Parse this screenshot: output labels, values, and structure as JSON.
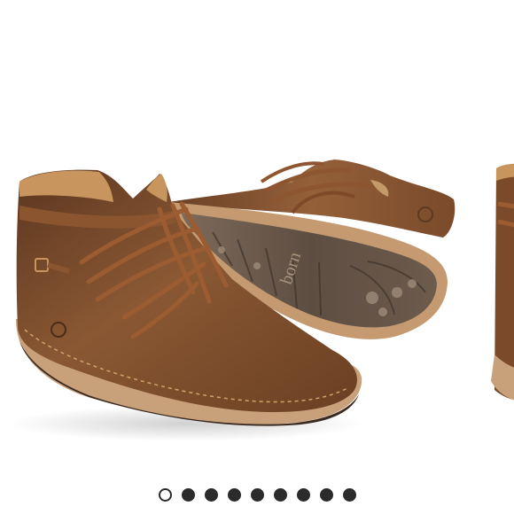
{
  "carousel": {
    "product_image": "brown-suede-ankle-boot-pair",
    "sole_logo_text": "born",
    "slide_count": 9,
    "active_index": 0
  },
  "colors": {
    "dot_active_fill": "#ffffff",
    "dot_inactive_fill": "#2b2b2b",
    "leather": "#7a4a2a",
    "sole": "#c8a07a"
  }
}
